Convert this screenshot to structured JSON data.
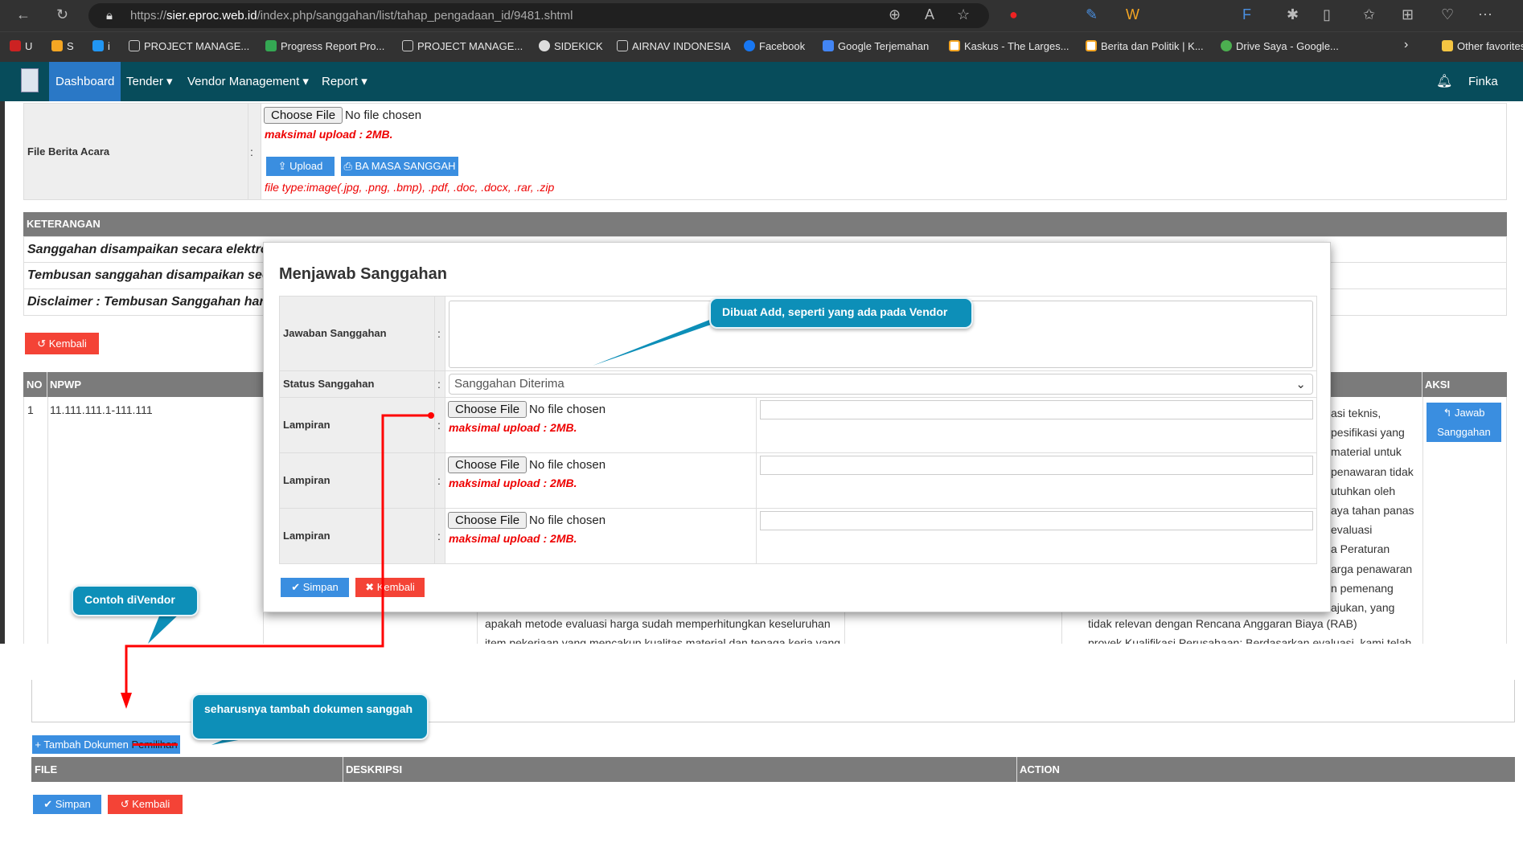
{
  "browser": {
    "url_host": "sier.eproc.web.id",
    "url_prefix": "https://",
    "url_path": "/index.php/sanggahan/list/tahap_pengadaan_id/9481.shtml",
    "bookmarks": [
      "U",
      "S",
      "i",
      "PROJECT MANAGE...",
      "Progress Report Pro...",
      "PROJECT MANAGE...",
      "SIDEKICK",
      "AIRNAV INDONESIA",
      "Facebook",
      "Google Terjemahan",
      "Kaskus - The Larges...",
      "Berita dan Politik | K...",
      "Drive Saya - Google..."
    ],
    "other_favorites": "Other favorites"
  },
  "nav": {
    "items": [
      "Dashboard",
      "Tender ▾",
      "Vendor Management ▾",
      "Report ▾"
    ],
    "user": "Finka"
  },
  "upload_form": {
    "label": "File Berita Acara",
    "colon": ":",
    "choose_file": "Choose File",
    "no_file": "No file chosen",
    "max_upload": "maksimal upload : 2MB.",
    "upload_btn": "⇪ Upload",
    "ba_btn": "⎙ BA MASA SANGGAH",
    "file_types": "file type:image(.jpg, .png, .bmp), .pdf, .doc, .docx, .rar, .zip"
  },
  "keterangan": {
    "header": "KETERANGAN",
    "lines": [
      "Sanggahan disampaikan secara elektro",
      "Tembusan sanggahan disampaikan sec",
      "Disclaimer : Tembusan Sanggahan haru"
    ]
  },
  "kembali_top": "↺ Kembali",
  "table": {
    "headers": {
      "no": "NO",
      "npwp": "NPWP",
      "aksi": "AKSI"
    },
    "row": {
      "no": "1",
      "npwp": "11.111.111.1-111.111",
      "jawab_btn_line1": "↰ Jawab",
      "jawab_btn_line2": "Sanggahan",
      "right_fragments": [
        "asi teknis,",
        "pesifikasi yang",
        "material untuk",
        "penawaran tidak",
        "utuhkan oleh",
        "aya tahan panas",
        "evaluasi",
        "a Peraturan",
        "arga penawaran",
        "n pemenang",
        "ajukan, yang"
      ],
      "right_full": "tidak relevan dengan Rencana Anggaran Biaya (RAB)",
      "right_cut": "proyek Kualifikasi Perusahaan: Berdasarkan evaluasi, kami telah",
      "mid_line1": "apakah metode evaluasi harga sudah memperhitungkan keseluruhan",
      "mid_line2": "item pekerjaan yang mencakup kualitas material dan tenaga kerja yang"
    }
  },
  "modal": {
    "title": "Menjawab Sanggahan",
    "jawaban_label": "Jawaban Sanggahan",
    "status_label": "Status Sanggahan",
    "status_value": "Sanggahan Diterima",
    "lampiran_label": "Lampiran",
    "choose_file": "Choose File",
    "no_file": "No file chosen",
    "max_upload": "maksimal upload : 2MB.",
    "simpan": "✔ Simpan",
    "kembali": "✖ Kembali"
  },
  "annotations": {
    "callout_add": "Dibuat Add, seperti yang ada pada Vendor",
    "callout_vendor": "Contoh diVendor",
    "callout_tambah": "seharusnya tambah dokumen sanggah"
  },
  "bottom": {
    "tambah_btn": "+ Tambah Dokumen ",
    "tambah_btn_struck": "Pemilihan",
    "headers": [
      "FILE",
      "DESKRIPSI",
      "ACTION"
    ],
    "simpan": "✔ Simpan",
    "kembali": "↺ Kembali"
  }
}
